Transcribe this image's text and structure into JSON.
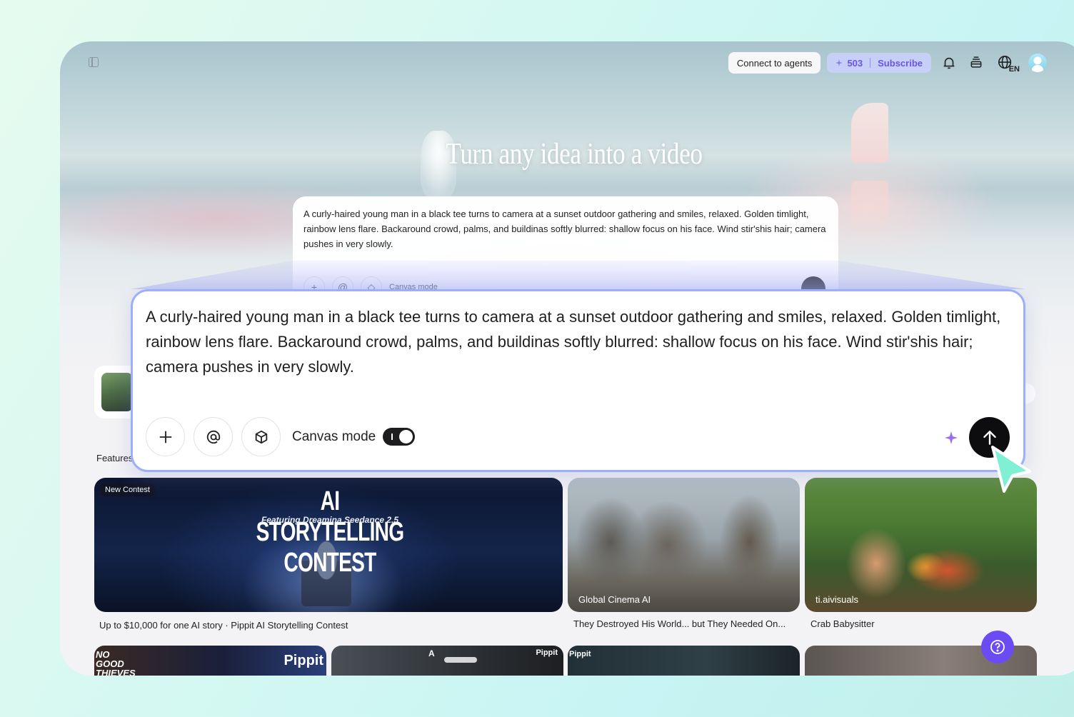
{
  "header": {
    "connect_label": "Connect to agents",
    "credits_count": "503",
    "subscribe_label": "Subscribe",
    "language_code": "EN"
  },
  "hero": {
    "title": "Turn any idea into a video"
  },
  "prompt": {
    "text": "A curly-haired young man in a black tee turns to camera at a sunset outdoor gathering and smiles, relaxed. Golden timlight, rainbow lens flare. Backaround crowd, palms, and buildinas softly blurred: shallow focus on his face. Wind stir'shis hair; camera pushes in very slowly.",
    "canvas_mode_label": "Canvas mode",
    "canvas_mode_on": true
  },
  "features": {
    "label": "Features"
  },
  "cards": [
    {
      "badge": "New Contest",
      "title": "AI STORYTELLING CONTEST",
      "subtitle": "Featuring Dreamina Seedance 2.5",
      "caption": "Up to $10,000 for one AI story · Pippit AI Storytelling Contest"
    },
    {
      "overlay": "Global Cinema AI",
      "caption": "They Destroyed His World... but They Needed On..."
    },
    {
      "overlay": "ti.aivisuals",
      "caption": "Crab Babysitter"
    }
  ],
  "row2": {
    "thieves_text": "NO GOOD THIEVES",
    "pippit_logo": "Pippit",
    "pippit_small": "Pippit",
    "poster_letter": "A"
  },
  "colors": {
    "accent": "#6b4cf3",
    "credits_text": "#6a55e8",
    "prompt_border": "#9db0f7"
  },
  "icons": [
    "sidebar-toggle-icon",
    "bell-icon",
    "stack-icon",
    "globe-icon",
    "plus-icon",
    "at-icon",
    "cube-icon",
    "sparkle-icon",
    "arrow-up-icon",
    "help-icon",
    "cursor-icon"
  ]
}
